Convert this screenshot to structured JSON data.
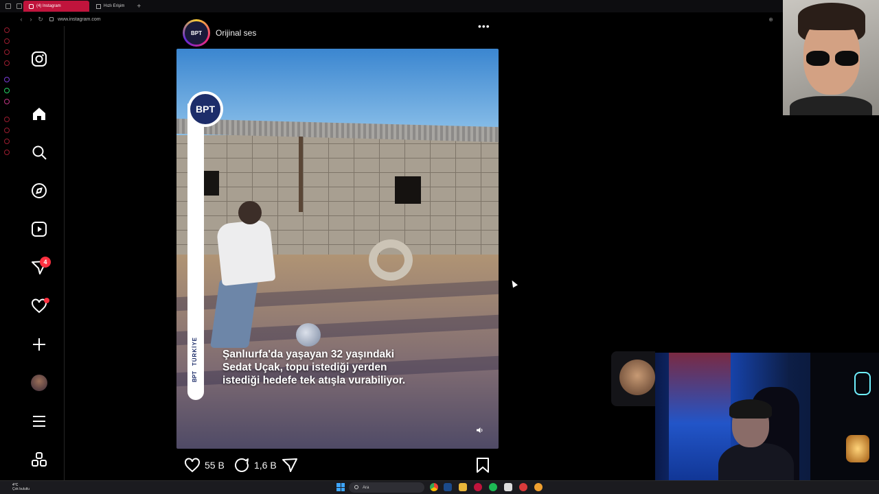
{
  "browser": {
    "tabs": [
      {
        "label": "(4) Instagram",
        "active": true
      },
      {
        "label": "Hızlı Erişim",
        "active": false
      }
    ],
    "url": "www.instagram.com"
  },
  "nav": {
    "items": [
      "instagram-logo",
      "home",
      "search",
      "explore",
      "reels",
      "messages",
      "notifications",
      "create",
      "profile",
      "more",
      "also-from-meta"
    ],
    "messages_badge": "4"
  },
  "post": {
    "audio_label": "Orijinal ses",
    "more_label": "•••",
    "overlay_logo": "BPT",
    "side_text_country": "TÜRKİYE",
    "side_text_brand": "BPT",
    "caption_lines": [
      "Şanlıurfa'da yaşayan 32 yaşındaki",
      "Sedat Uçak, topu istediği yerden",
      "istediği hedefe tek atışla vurabiliyor."
    ],
    "likes": "55 B",
    "comments": "1,6 B"
  },
  "taskbar": {
    "weather_temp": "4°C",
    "weather_desc": "Çok bulutlu",
    "search_placeholder": "Ara"
  },
  "colors": {
    "active_tab": "#c0143c",
    "badge": "#ff3040",
    "background": "#000000",
    "text": "#f5f5f5"
  }
}
